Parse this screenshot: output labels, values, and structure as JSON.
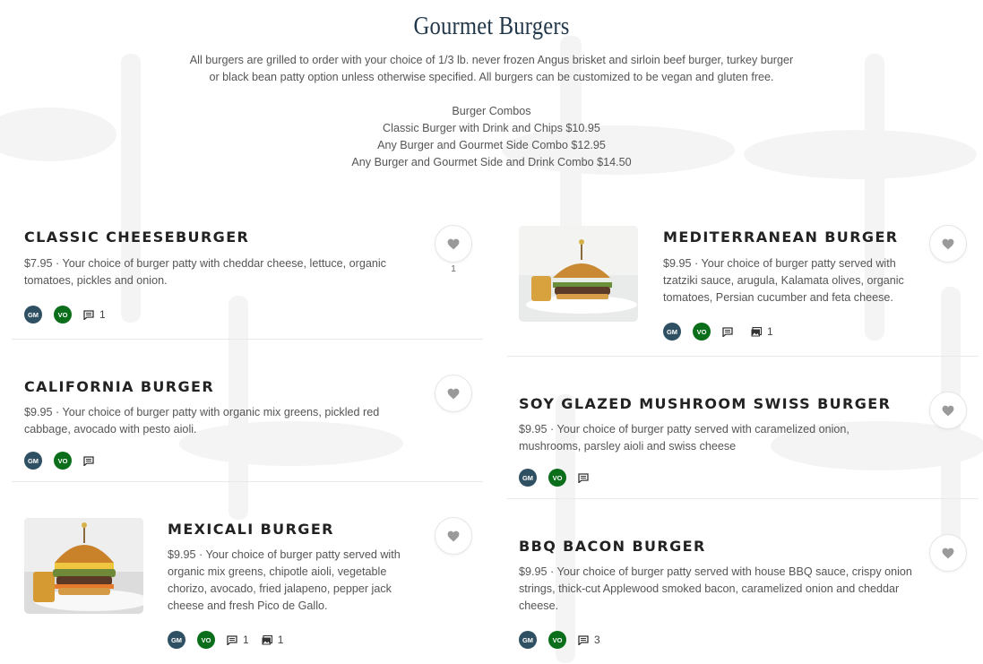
{
  "header": {
    "title": "Gourmet Burgers",
    "intro": "All burgers are grilled to order with your choice of 1/3 lb. never frozen Angus brisket and sirloin beef burger, turkey burger or black bean patty option unless otherwise specified. All burgers can be customized to be vegan and gluten free.",
    "combos_heading": "Burger Combos",
    "combos": [
      "Classic Burger with Drink and Chips $10.95",
      "Any Burger and Gourmet Side Combo $12.95",
      "Any Burger and Gourmet Side and Drink Combo $14.50"
    ]
  },
  "tag_labels": {
    "gm": "GM",
    "vo": "VO"
  },
  "icons": {
    "favorite": "heart-icon",
    "comments": "comment-icon",
    "photos": "photo-icon"
  },
  "colors": {
    "gm": "#2f5062",
    "vo": "#0a6e1a",
    "title": "#22384a"
  },
  "items": [
    {
      "name": "Classic Cheeseburger",
      "description": "$7.95 · Your choice of burger patty with cheddar cheese, lettuce, organic tomatoes, pickles and onion.",
      "comments": "1",
      "favorites": "1"
    },
    {
      "name": "Mediterranean Burger",
      "description": "$9.95 · Your choice of burger patty served with tzatziki sauce, arugula, Kalamata olives, organic tomatoes, Persian cucumber and feta cheese.",
      "photos": "1"
    },
    {
      "name": "California Burger",
      "description": "$9.95 · Your choice of burger patty with organic mix greens, pickled red cabbage, avocado with pesto aioli."
    },
    {
      "name": "Soy Glazed Mushroom Swiss Burger",
      "description": "$9.95 · Your choice of burger patty served with caramelized onion, mushrooms, parsley aioli and swiss cheese"
    },
    {
      "name": "Mexicali Burger",
      "description": "$9.95 · Your choice of burger patty served with organic mix greens, chipotle aioli, vegetable chorizo, avocado, fried jalapeno, pepper jack cheese and fresh Pico de Gallo.",
      "comments": "1",
      "photos": "1"
    },
    {
      "name": "BBQ Bacon Burger",
      "description": "$9.95 · Your choice of burger patty served with house BBQ sauce, crispy onion strings, thick-cut Applewood smoked bacon, caramelized onion and cheddar cheese.",
      "comments": "3"
    }
  ]
}
